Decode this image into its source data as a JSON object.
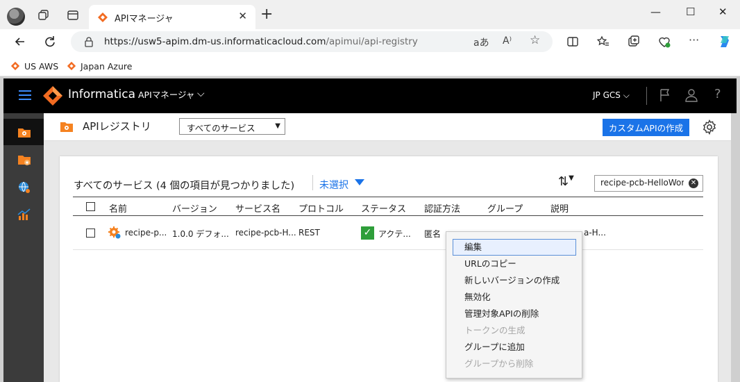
{
  "browser": {
    "tab_title": "APIマネージャ",
    "url_host": "https://usw5-apim.dm-us.informaticacloud.com",
    "url_path": "/apimui/api-registry",
    "bookmarks": [
      {
        "label": "US AWS",
        "icon": "informatica-icon"
      },
      {
        "label": "Japan Azure",
        "icon": "informatica-icon"
      }
    ]
  },
  "header": {
    "brand": "Informatica",
    "app_name": "APIマネージャ",
    "org": "JP GCS"
  },
  "toolbar": {
    "title": "APIレジストリ",
    "service_filter": "すべてのサービス",
    "create_button": "カスタムAPIの作成"
  },
  "panel": {
    "title": "すべてのサービス (4 個の項目が見つかりました)",
    "selection_filter": "未選択",
    "search_value": "recipe-pcb-HelloWorl",
    "columns": [
      "名前",
      "バージョン",
      "サービス名",
      "プロトコル",
      "ステータス",
      "認証方法",
      "グループ",
      "説明"
    ],
    "rows": [
      {
        "name": "recipe-p...",
        "version": "1.0.0 デフォ...",
        "service": "recipe-pcb-H...",
        "protocol": "REST",
        "status": "アクテ...",
        "auth": "匿名",
        "group": "",
        "description": "a-H..."
      }
    ]
  },
  "context_menu": {
    "items": [
      {
        "label": "編集",
        "state": "selected"
      },
      {
        "label": "URLのコピー",
        "state": "enabled"
      },
      {
        "label": "新しいバージョンの作成",
        "state": "enabled"
      },
      {
        "label": "無効化",
        "state": "enabled"
      },
      {
        "label": "管理対象APIの削除",
        "state": "enabled"
      },
      {
        "label": "トークンの生成",
        "state": "disabled"
      },
      {
        "label": "グループに追加",
        "state": "enabled"
      },
      {
        "label": "グループから削除",
        "state": "disabled"
      }
    ]
  },
  "colors": {
    "accent": "#1a73e8",
    "brand_orange": "#f26b21",
    "status_green": "#2e9e3a"
  }
}
